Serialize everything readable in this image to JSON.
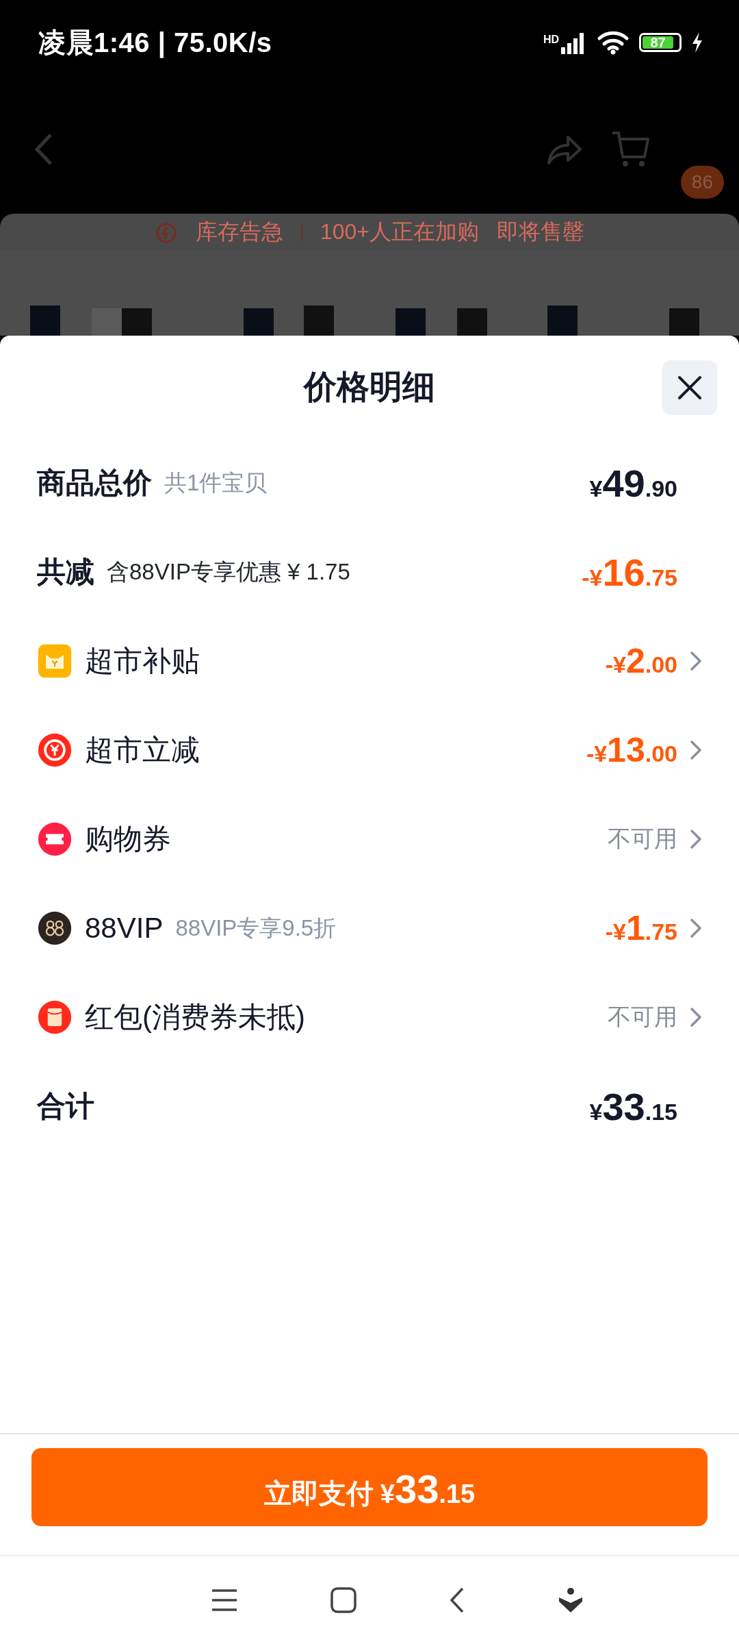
{
  "status_bar": {
    "time": "凌晨1:46 | 75.0K/s",
    "network": "HD",
    "battery": "87"
  },
  "background_page": {
    "cart_badge": "86",
    "banner": [
      "库存告急",
      "100+人正在加购",
      "即将售罄"
    ]
  },
  "sheet": {
    "title": "价格明细",
    "rows": [
      {
        "kind": "summary",
        "label": "商品总价",
        "note": "共1件宝贝",
        "value": "¥49.90",
        "discount": false,
        "disabled": false
      },
      {
        "kind": "summary",
        "label": "共减",
        "note": "含88VIP专享优惠 ¥ 1.75",
        "value": "-¥16.75",
        "discount": true,
        "disabled": false
      },
      {
        "kind": "option",
        "label": "超市补贴",
        "value": "-¥2.00",
        "discount": true,
        "disabled": false
      },
      {
        "kind": "option",
        "label": "超市立减",
        "value": "-¥13.00",
        "discount": true,
        "disabled": false
      },
      {
        "kind": "option",
        "label": "购物券",
        "value": "不可用",
        "disabled": true
      },
      {
        "kind": "option",
        "label": "88VIP",
        "note": "88VIP专享9.5折",
        "value": "-¥1.75",
        "discount": true,
        "disabled": false
      },
      {
        "kind": "option",
        "label": "红包(消费券未抵)",
        "value": "不可用",
        "disabled": true
      },
      {
        "kind": "summary",
        "label": "合计",
        "value": "¥33.15",
        "discount": false,
        "disabled": false
      }
    ]
  },
  "pay_button": {
    "label": "立即支付",
    "amount": "¥33.15"
  }
}
